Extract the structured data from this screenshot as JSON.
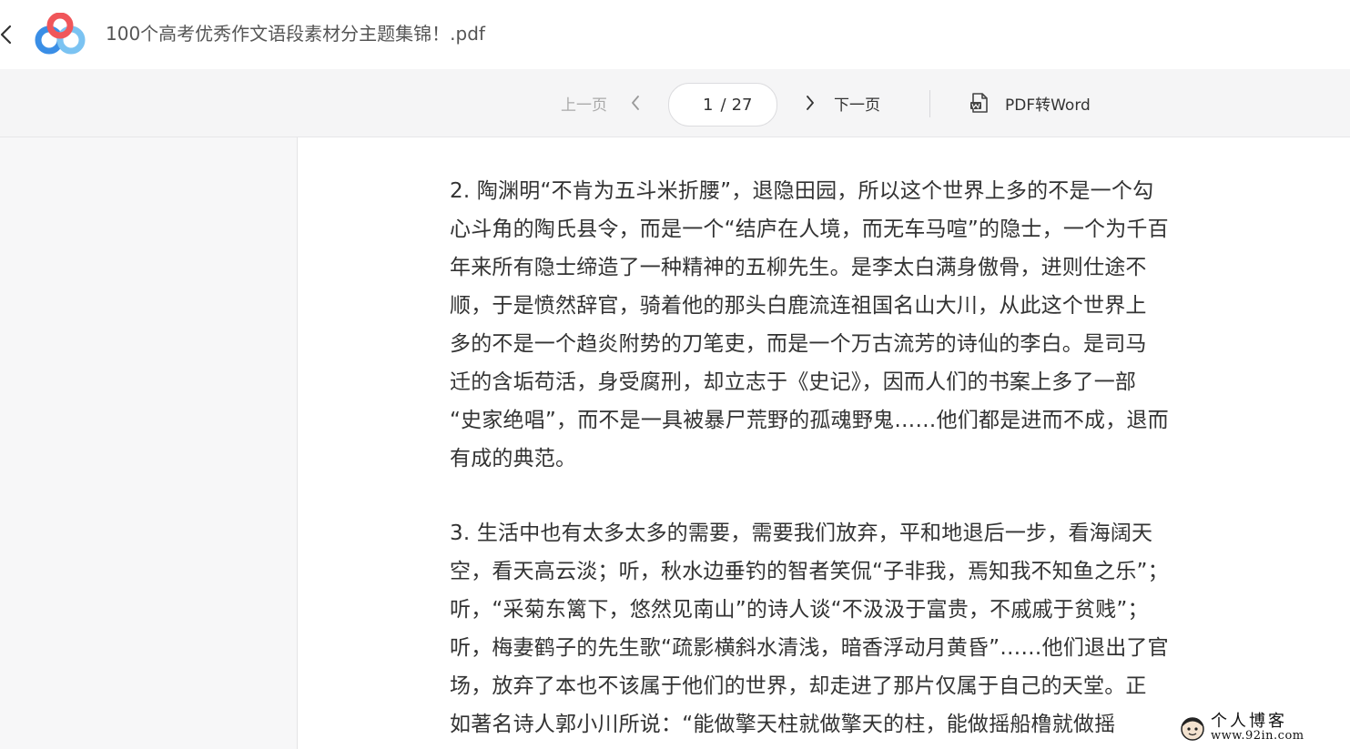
{
  "header": {
    "title": "100个高考优秀作文语段素材分主题集锦！.pdf"
  },
  "toolbar": {
    "prev_label": "上一页",
    "next_label": "下一页",
    "current_page": "1",
    "page_separator": "/",
    "total_pages": "27",
    "convert_label": "PDF转Word"
  },
  "document": {
    "paragraph_2_lines": [
      "2. 陶渊明“不肯为五斗米折腰”，退隐田园，所以这个世界上多的不是一个勾",
      "心斗角的陶氏县令，而是一个“结庐在人境，而无车马喧”的隐士，一个为千百",
      "年来所有隐士缔造了一种精神的五柳先生。是李太白满身傲骨，进则仕途不",
      "顺，于是愤然辞官，骑着他的那头白鹿流连祖国名山大川，从此这个世界上",
      "多的不是一个趋炎附势的刀笔吏，而是一个万古流芳的诗仙的李白。是司马",
      "迁的含垢苟活，身受腐刑，却立志于《史记》，因而人们的书案上多了一部",
      "“史家绝唱”，而不是一具被暴尸荒野的孤魂野鬼……他们都是进而不成，退而",
      "有成的典范。"
    ],
    "paragraph_3_lines": [
      "3. 生活中也有太多太多的需要，需要我们放弃，平和地退后一步，看海阔天",
      "空，看天高云淡；听，秋水边垂钓的智者笑侃“子非我，焉知我不知鱼之乐”；",
      "听，“采菊东篱下，悠然见南山”的诗人谈“不汲汲于富贵，不戚戚于贫贱”；",
      "听，梅妻鹤子的先生歌“疏影横斜水清浅，暗香浮动月黄昏”……他们退出了官",
      "场，放弃了本也不该属于他们的世界，却走进了那片仅属于自己的天堂。正",
      "如著名诗人郭小川所说：“能做擎天柱就做擎天的柱，能做摇船橹就做摇"
    ]
  },
  "watermark": {
    "line1": "个人博客",
    "line2": "www.92in.com"
  },
  "colors": {
    "logo_blue": "#3a8ee6",
    "logo_red": "#f0565a",
    "logo_light_blue": "#7bc3f2"
  }
}
